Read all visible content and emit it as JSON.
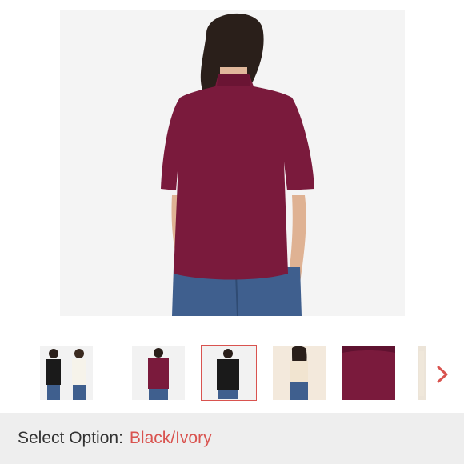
{
  "product": {
    "main_image": {
      "alt": "model-back-view",
      "shirt_color": "#7a1a3c",
      "jeans_color": "#3f5f8e"
    },
    "thumbnails": [
      {
        "name": "black-and-ivory",
        "selected": false
      },
      {
        "name": "burgundy-back",
        "selected": false
      },
      {
        "name": "black-back",
        "selected": true
      },
      {
        "name": "ivory-front",
        "selected": false
      },
      {
        "name": "burgundy-fabric-closeup",
        "selected": false
      },
      {
        "name": "partial-next",
        "selected": false
      }
    ],
    "next_icon": "chevron-right-icon"
  },
  "option": {
    "label": "Select Option:",
    "value": "Black/Ivory",
    "value_color": "#d9534f"
  }
}
